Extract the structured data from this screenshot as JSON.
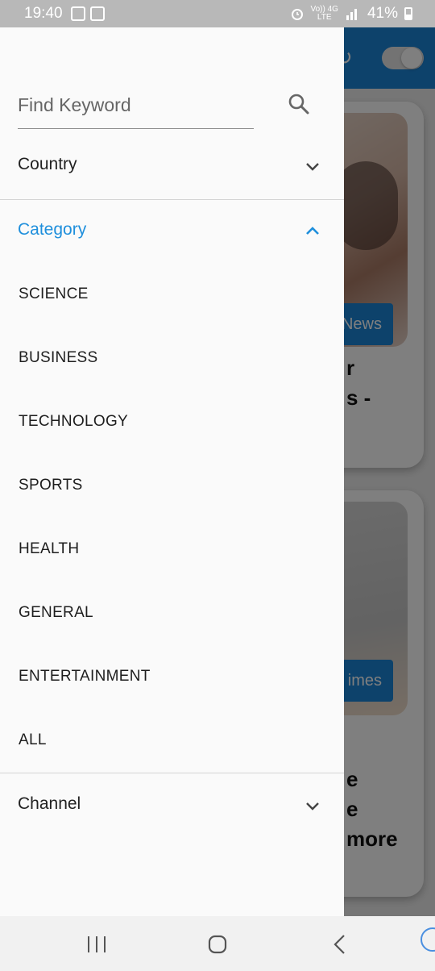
{
  "status_bar": {
    "time": "19:40",
    "network_top": "Vo)) 4G",
    "network_bottom": "LTE",
    "battery": "41%"
  },
  "background": {
    "badge_1": "News",
    "badge_2": "imes",
    "card_1_text": "r\ns -",
    "card_2_text": "e\ne\nmore"
  },
  "drawer": {
    "search": {
      "placeholder": "Find Keyword",
      "value": ""
    },
    "country": {
      "label": "Country",
      "expanded": false
    },
    "category": {
      "label": "Category",
      "expanded": true,
      "accent_color": "#1f8fdc",
      "items": [
        {
          "label": "SCIENCE"
        },
        {
          "label": "BUSINESS"
        },
        {
          "label": "TECHNOLOGY"
        },
        {
          "label": "SPORTS"
        },
        {
          "label": "HEALTH"
        },
        {
          "label": "GENERAL"
        },
        {
          "label": "ENTERTAINMENT"
        },
        {
          "label": "ALL"
        }
      ]
    },
    "channel": {
      "label": "Channel",
      "expanded": false
    }
  },
  "colors": {
    "app_bar": "#1b84d6",
    "drawer_background": "#fafafa"
  }
}
